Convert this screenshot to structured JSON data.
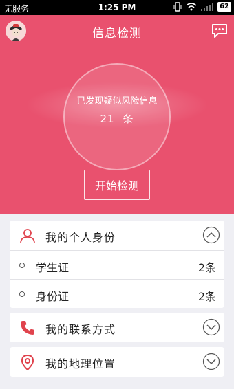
{
  "status_bar": {
    "carrier": "无服务",
    "time": "1:25 PM",
    "battery": "62"
  },
  "header": {
    "title": "信息检测"
  },
  "risk": {
    "prefix": "已发现疑似风险信息",
    "count": "21",
    "unit": "条"
  },
  "actions": {
    "start_label": "开始检测"
  },
  "sections": {
    "identity": {
      "label": "我的个人身份",
      "items": [
        {
          "name": "学生证",
          "count": "2条"
        },
        {
          "name": "身份证",
          "count": "2条"
        }
      ]
    },
    "contact": {
      "label": "我的联系方式"
    },
    "location": {
      "label": "我的地理位置"
    }
  },
  "colors": {
    "brand": "#e9516e",
    "icon_red": "#e0434d",
    "background": "#efeff4"
  },
  "icons": [
    "avatar",
    "chat-bubble-icon",
    "person-icon",
    "phone-icon",
    "location-pin-icon",
    "chevron-up-icon",
    "chevron-down-icon"
  ]
}
